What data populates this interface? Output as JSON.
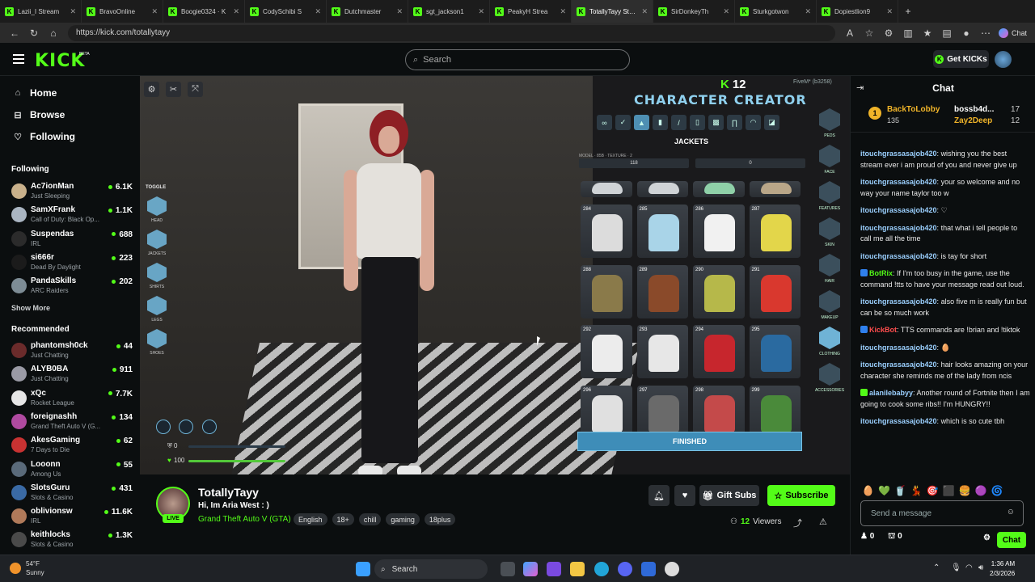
{
  "browser": {
    "tabs": [
      {
        "label": "Lazii_I Stream",
        "active": false
      },
      {
        "label": "BravoOnline",
        "active": false
      },
      {
        "label": "Boogie0324 · K",
        "active": false
      },
      {
        "label": "CodySchibi S",
        "active": false
      },
      {
        "label": "Dutchmaster",
        "active": false
      },
      {
        "label": "sgt_jackson1",
        "active": false
      },
      {
        "label": "PeakyH Strea",
        "active": false
      },
      {
        "label": "TotallyTayy Strea",
        "active": true
      },
      {
        "label": "SirDonkeyTh",
        "active": false
      },
      {
        "label": "Sturkgotwon",
        "active": false
      },
      {
        "label": "Dopiestlion9",
        "active": false
      }
    ],
    "url": "https://kick.com/totallytayy",
    "copilot_label": "Chat"
  },
  "header": {
    "logo": "KICK",
    "beta": "BETA",
    "search_placeholder": "Search",
    "get_kicks_label": "Get KICKs"
  },
  "sidebar": {
    "nav": [
      {
        "label": "Home",
        "icon": "home-icon"
      },
      {
        "label": "Browse",
        "icon": "browse-icon"
      },
      {
        "label": "Following",
        "icon": "heart-icon"
      }
    ],
    "following_title": "Following",
    "following": [
      {
        "name": "Ac7ionMan",
        "category": "Just Sleeping",
        "viewers": "6.1K",
        "color": "#c9b18b"
      },
      {
        "name": "SamXFrank",
        "category": "Call of Duty: Black Op...",
        "viewers": "1.1K",
        "color": "#aab5c2"
      },
      {
        "name": "Suspendas",
        "category": "IRL",
        "viewers": "688",
        "color": "#2b2b2b"
      },
      {
        "name": "si666r",
        "category": "Dead By Daylight",
        "viewers": "223",
        "color": "#1b1b1b"
      },
      {
        "name": "PandaSkills",
        "category": "ARC Raiders",
        "viewers": "202",
        "color": "#7d8c95"
      }
    ],
    "show_more": "Show More",
    "recommended_title": "Recommended",
    "recommended": [
      {
        "name": "phantomsh0ck",
        "category": "Just Chatting",
        "viewers": "44",
        "color": "#6b2b2b"
      },
      {
        "name": "ALYB0BA",
        "category": "Just Chatting",
        "viewers": "911",
        "color": "#9a9aa5"
      },
      {
        "name": "xQc",
        "category": "Rocket League",
        "viewers": "7.7K",
        "color": "#e6e6e6"
      },
      {
        "name": "foreignashh",
        "category": "Grand Theft Auto V (G...",
        "viewers": "134",
        "color": "#b04aa0"
      },
      {
        "name": "AkesGaming",
        "category": "7 Days to Die",
        "viewers": "62",
        "color": "#c83232"
      },
      {
        "name": "Looonn",
        "category": "Among Us",
        "viewers": "55",
        "color": "#5a6a7a"
      },
      {
        "name": "SlotsGuru",
        "category": "Slots & Casino",
        "viewers": "431",
        "color": "#3a6aa5"
      },
      {
        "name": "oblivionsw",
        "category": "IRL",
        "viewers": "11.6K",
        "color": "#b07a5a"
      },
      {
        "name": "keithlocks",
        "category": "Slots & Casino",
        "viewers": "1.3K",
        "color": "#4a4a4a"
      }
    ]
  },
  "video": {
    "kicks_count": "12",
    "fivem_label": "FiveM* (b3258)",
    "toggle_title": "TOGGLE",
    "toggle_items": [
      "HEAD",
      "JACKETS",
      "SHIRTS",
      "LEGS",
      "SHOES"
    ],
    "hud_armor": "0",
    "hud_health": "100",
    "creator": {
      "title": "CHARACTER CREATOR",
      "section": "JACKETS",
      "slider_labels": "MODEL · 85B · TEXTURE · 2",
      "slider_values": [
        "118",
        "0"
      ],
      "items": [
        {
          "num": "",
          "color": "#cfd3d6"
        },
        {
          "num": "",
          "color": "#cfd3d6"
        },
        {
          "num": "",
          "color": "#8fd0a8"
        },
        {
          "num": "",
          "color": "#b9a688"
        },
        {
          "num": "284",
          "color": "#dcdcdc"
        },
        {
          "num": "285",
          "color": "#a9d4e8"
        },
        {
          "num": "286",
          "color": "#f1f1f1"
        },
        {
          "num": "287",
          "color": "#e3d64a"
        },
        {
          "num": "288",
          "color": "#8a7a4a"
        },
        {
          "num": "289",
          "color": "#8a4a2a"
        },
        {
          "num": "290",
          "color": "#b6b84a"
        },
        {
          "num": "291",
          "color": "#d9382e"
        },
        {
          "num": "292",
          "color": "#ececec"
        },
        {
          "num": "293",
          "color": "#e7e7e7"
        },
        {
          "num": "294",
          "color": "#c7262d"
        },
        {
          "num": "295",
          "color": "#2a6aa0"
        },
        {
          "num": "296",
          "color": "#e0e0e0"
        },
        {
          "num": "297",
          "color": "#6a6a6a"
        },
        {
          "num": "298",
          "color": "#c44a4a"
        },
        {
          "num": "299",
          "color": "#4a8a3a"
        }
      ],
      "finished_label": "FINISHED",
      "right_sections": [
        "PEDS",
        "FACE",
        "FEATURES",
        "SKIN",
        "HAIR",
        "MAKEUP",
        "CLOTHING",
        "ACCESSORIES"
      ]
    }
  },
  "stream": {
    "streamer": "TotallyTayy",
    "live_badge": "LIVE",
    "title": "Hi, Im Aria West : )",
    "game": "Grand Theft Auto V (GTA)",
    "tags": [
      "English",
      "18+",
      "chill",
      "gaming",
      "18plus"
    ],
    "gift_subs_label": "Gift Subs",
    "subscribe_label": "Subscribe",
    "viewers_count": "12",
    "viewers_label": "Viewers"
  },
  "chat": {
    "title": "Chat",
    "leaderboard": [
      {
        "rank": "1",
        "name": "BackToLobby",
        "count": "135",
        "color": "#f0b429"
      },
      {
        "name": "bossb4d...",
        "count": "17",
        "color": "#fff"
      },
      {
        "name": "Zay2Deep",
        "count": "12",
        "color": "#f0b429"
      }
    ],
    "messages": [
      {
        "user": "itouchgrassasajob420",
        "text": "wishing you the best stream ever i am proud of you and never give up",
        "color": "#9bd0ff",
        "badge": ""
      },
      {
        "user": "itouchgrassasajob420",
        "text": "your so welcome and no way your name taylor too w",
        "color": "#9bd0ff",
        "badge": ""
      },
      {
        "user": "itouchgrassasajob420",
        "text": "♡",
        "color": "#9bd0ff",
        "badge": ""
      },
      {
        "user": "itouchgrassasajob420",
        "text": "that what i tell people to call me all the time",
        "color": "#9bd0ff",
        "badge": ""
      },
      {
        "user": "itouchgrassasajob420",
        "text": "is tay for short",
        "color": "#9bd0ff",
        "badge": ""
      },
      {
        "user": "BotRix",
        "text": "If I'm too busy in the game, use the command !tts to have your message read out loud.",
        "color": "#53fc18",
        "badge": "#2f80ed"
      },
      {
        "user": "itouchgrassasajob420",
        "text": "also five m is really fun but can be so much work",
        "color": "#9bd0ff",
        "badge": ""
      },
      {
        "user": "KickBot",
        "text": "TTS commands are !brian and !tiktok",
        "color": "#ff4d4d",
        "badge": "#2f80ed"
      },
      {
        "user": "itouchgrassasajob420",
        "text": "🥚",
        "color": "#9bd0ff",
        "badge": ""
      },
      {
        "user": "itouchgrassasajob420",
        "text": "hair looks amazing on your character she reminds me of the lady from ncis",
        "color": "#9bd0ff",
        "badge": ""
      },
      {
        "user": "alanilebabyy",
        "text": "Another round of Fortnite then I am going to cook some ribs!! I'm HUNGRY!!",
        "color": "#9bd0ff",
        "badge": "#53fc18"
      },
      {
        "user": "itouchgrassasajob420",
        "text": "which is so cute tbh",
        "color": "#9bd0ff",
        "badge": ""
      }
    ],
    "input_placeholder": "Send a message",
    "kicks_balance": "0",
    "points_balance": "0",
    "send_label": "Chat"
  },
  "taskbar": {
    "temperature": "54°F",
    "weather": "Sunny",
    "search_label": "Search",
    "time": "1:36 AM",
    "date": "2/3/2026"
  }
}
